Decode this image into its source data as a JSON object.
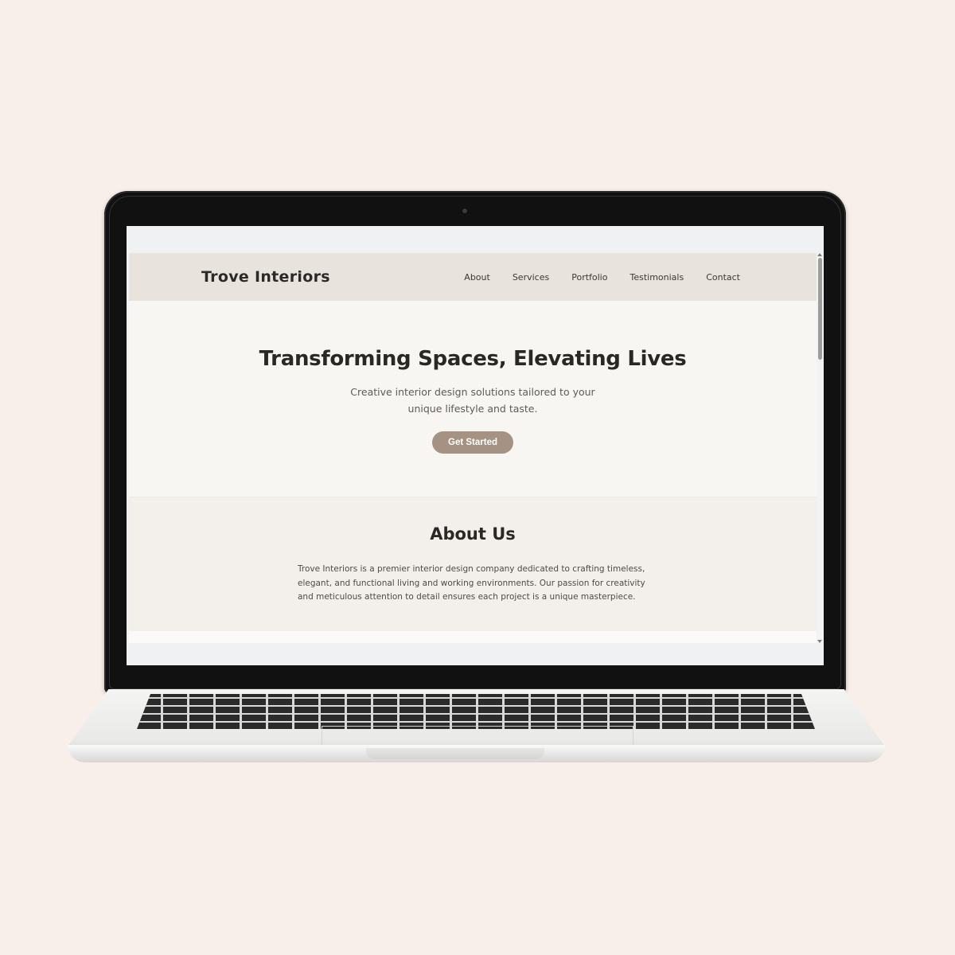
{
  "site": {
    "brand": "Trove Interiors",
    "nav": [
      "About",
      "Services",
      "Portfolio",
      "Testimonials",
      "Contact"
    ]
  },
  "hero": {
    "title": "Transforming Spaces, Elevating Lives",
    "subtitle": "Creative interior design solutions tailored to your unique lifestyle and taste.",
    "cta_label": "Get Started"
  },
  "about": {
    "title": "About Us",
    "text": "Trove Interiors is a premier interior design company dedicated to crafting timeless, elegant, and functional living and working environments. Our passion for creativity and meticulous attention to detail ensures each project is a unique masterpiece."
  },
  "colors": {
    "page_background": "#f9efea",
    "nav_background": "#e8e3dd",
    "hero_background": "#f8f6f2",
    "about_background": "#f3f0eb",
    "accent": "#a59282",
    "text_dark": "#2a2826"
  }
}
